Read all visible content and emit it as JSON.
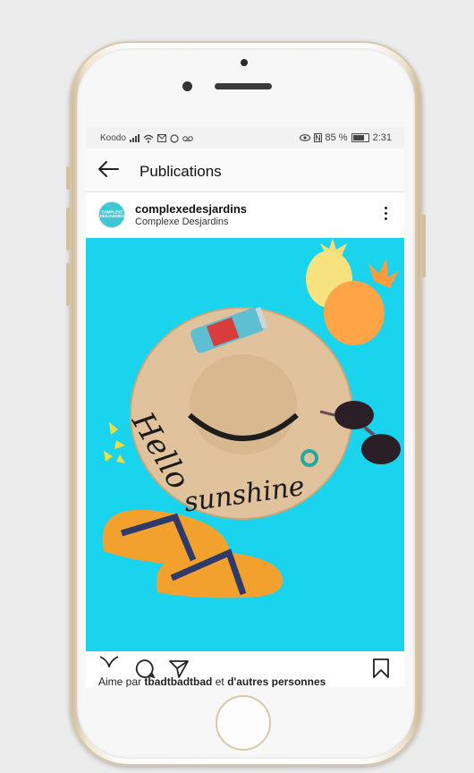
{
  "status_bar": {
    "carrier": "Koodo",
    "battery": "85 %",
    "time": "2:31"
  },
  "app_bar": {
    "title": "Publications"
  },
  "post": {
    "username": "complexedesjardins",
    "full_name": "Complexe Desjardins",
    "avatar_text": "COMPLEXE DESJARDINS",
    "photo_caption_text": "Hello sunshine",
    "likes_prefix": "Aime par",
    "likes_user": "tbadtbadtbad",
    "likes_middle": "et",
    "likes_others": "d'autres personnes"
  },
  "colors": {
    "photo_background": "#19d4ec",
    "accent": "#3fc7d3"
  },
  "icons": [
    "back-arrow-icon",
    "signal-icon",
    "wifi-icon",
    "more-icon",
    "heart-icon",
    "comment-icon",
    "share-icon",
    "bookmark-icon"
  ]
}
